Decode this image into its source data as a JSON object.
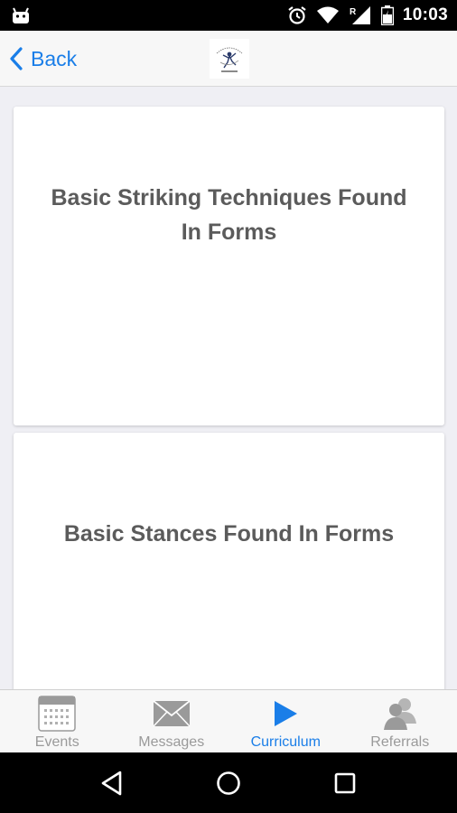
{
  "status_bar": {
    "time": "10:03",
    "icons": [
      "android-icon",
      "alarm-icon",
      "wifi-icon",
      "signal-icon",
      "battery-icon"
    ]
  },
  "header": {
    "back_label": "Back",
    "logo_icon": "school-logo-icon",
    "accent_color": "#1a7ee8"
  },
  "cards": [
    {
      "title": "Basic Striking Techniques Found In Forms"
    },
    {
      "title": "Basic Stances Found In Forms"
    }
  ],
  "tabs": [
    {
      "label": "Events",
      "icon": "calendar-icon",
      "active": false
    },
    {
      "label": "Messages",
      "icon": "envelope-icon",
      "active": false
    },
    {
      "label": "Curriculum",
      "icon": "play-icon",
      "active": true
    },
    {
      "label": "Referrals",
      "icon": "people-icon",
      "active": false
    }
  ],
  "android_nav": {
    "buttons": [
      "back-triangle-icon",
      "home-circle-icon",
      "recents-square-icon"
    ]
  }
}
